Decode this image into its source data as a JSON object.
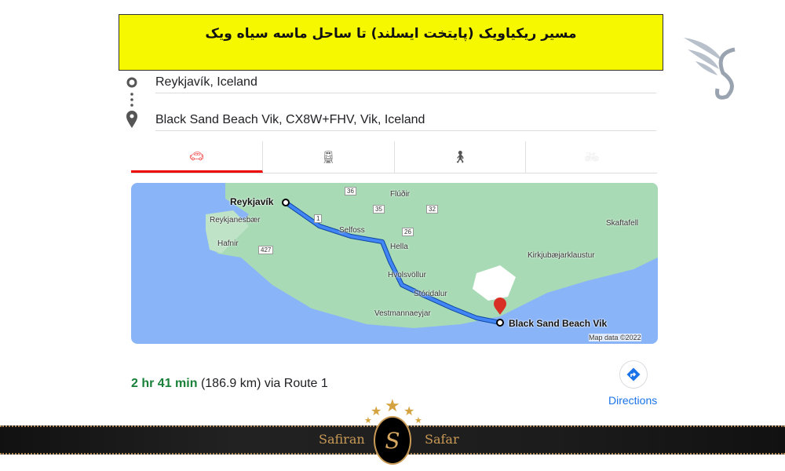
{
  "banner": {
    "title": "مسیر ریکیاویک (پایتخت ایسلند) تا ساحل ماسه سیاه ویک"
  },
  "route": {
    "origin": "Reykjavík, Iceland",
    "destination": "Black Sand Beach Vik, CX8W+FHV, Vik, Iceland"
  },
  "tabs": [
    {
      "icon": "car-icon",
      "active": true
    },
    {
      "icon": "train-icon"
    },
    {
      "icon": "walk-icon"
    },
    {
      "icon": "bicycle-icon"
    }
  ],
  "map": {
    "labels": {
      "reykjavik": "Reykjavík",
      "reykjanesbaer": "Reykjanesbær",
      "hafnir": "Hafnir",
      "fludir": "Flúðir",
      "selfoss": "Selfoss",
      "hella": "Hella",
      "hvolsvollur": "Hvolsvöllur",
      "storidalur": "Stóridalur",
      "vestmannaeyjar": "Vestmannaeyjar",
      "vik": "Black Sand Beach Vik",
      "kirkju": "Kirkjubæjarklaustur",
      "skaftafell": "Skaftafell",
      "copyright": "Map data ©2022"
    },
    "roads": {
      "r427": "427",
      "r1": "1",
      "r36": "36",
      "r35": "35",
      "r32": "32",
      "r26": "26"
    },
    "colors": {
      "water": "#8ab4f8",
      "land": "#a8dab5",
      "route": "#1a73e8",
      "pin": "#d93025"
    }
  },
  "summary": {
    "duration": "2 hr 41 min",
    "distance": "(186.9 km)",
    "via": "via Route 1"
  },
  "directions": {
    "label": "Directions"
  },
  "footer": {
    "left": "Safiran",
    "right": "Safar",
    "logo_letter": "S"
  }
}
